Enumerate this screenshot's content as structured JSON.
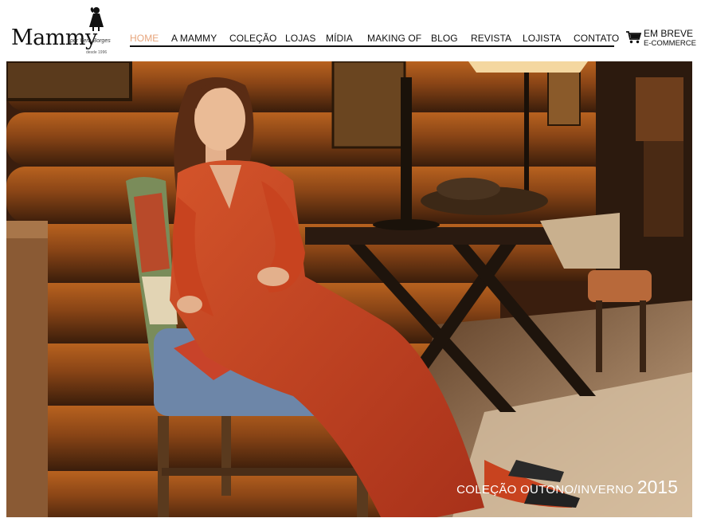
{
  "brand": {
    "name": "Mammy",
    "tagline": "por Vera Borges",
    "since": "desde 1996"
  },
  "nav": {
    "items": [
      {
        "label": "HOME",
        "active": true
      },
      {
        "label": "A MAMMY",
        "active": false
      },
      {
        "label": "COLEÇÃO",
        "active": false
      },
      {
        "label": "LOJAS",
        "active": false
      },
      {
        "label": "MÍDIA",
        "active": false
      },
      {
        "label": "MAKING OF",
        "active": false
      },
      {
        "label": "BLOG",
        "active": false
      },
      {
        "label": "REVISTA",
        "active": false
      },
      {
        "label": "LOJISTA",
        "active": false
      },
      {
        "label": "CONTATO",
        "active": false
      }
    ]
  },
  "cart": {
    "icon": "shopping-cart-icon",
    "line1": "EM BREVE",
    "line2": "E-COMMERCE"
  },
  "hero": {
    "caption_text": "COLEÇÃO OUTONO/INVERNO",
    "caption_year": "2015"
  },
  "colors": {
    "active_nav": "#e7a57c",
    "text": "#111111",
    "dress": "#c2401c"
  }
}
